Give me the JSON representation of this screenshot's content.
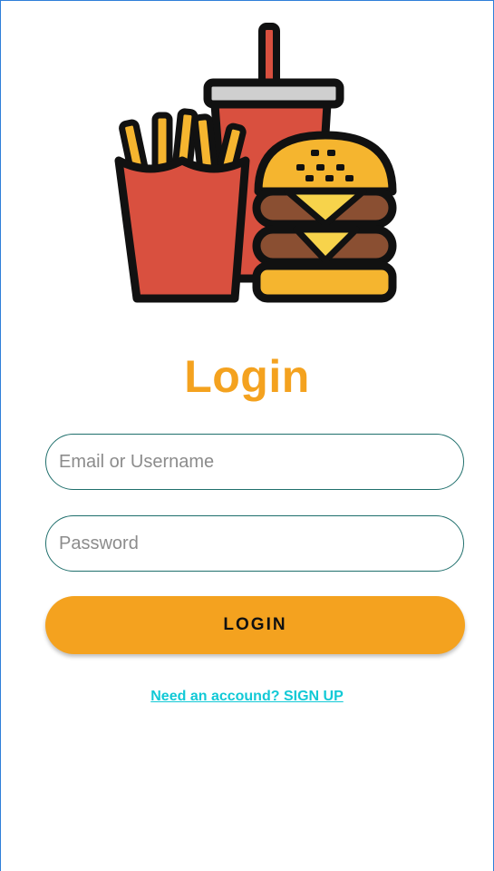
{
  "login": {
    "title": "Login",
    "email_placeholder": "Email or Username",
    "password_placeholder": "Password",
    "button_label": "LOGIN",
    "signup_link": "Need an accound? SIGN UP"
  },
  "colors": {
    "accent": "#f4a21f",
    "field_border": "#1f6f6c",
    "link": "#12c9d6",
    "fries_box": "#d9503f",
    "bun": "#f5b52f",
    "patty": "#8a4f32"
  },
  "icons": {
    "logo": "fast-food-burger-fries-drink-icon"
  }
}
